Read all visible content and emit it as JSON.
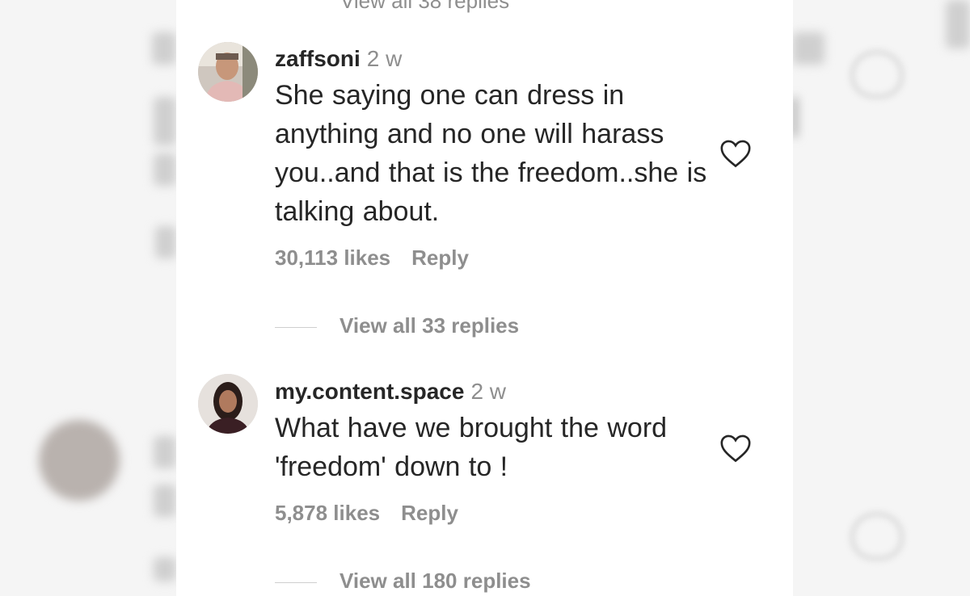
{
  "comments": [
    {
      "username": "zaffsoni",
      "time": "2 w",
      "text": "She saying one can dress in anything and no one will harass you..and that is the freedom..she is talking about.",
      "likes": "30,113 likes",
      "reply_label": "Reply",
      "view_replies": "View all 33 replies"
    },
    {
      "username": "my.content.space",
      "time": "2 w",
      "text": "What have we brought the word 'freedom' down to !",
      "likes": "5,878 likes",
      "reply_label": "Reply",
      "view_replies": "View all 180 replies"
    }
  ],
  "top_cut_text": "View all 38 replies",
  "colors": {
    "text": "#262626",
    "muted": "#8e8e8e",
    "panel": "#ffffff"
  },
  "icons": [
    "heart-outline-icon",
    "avatar-image"
  ]
}
